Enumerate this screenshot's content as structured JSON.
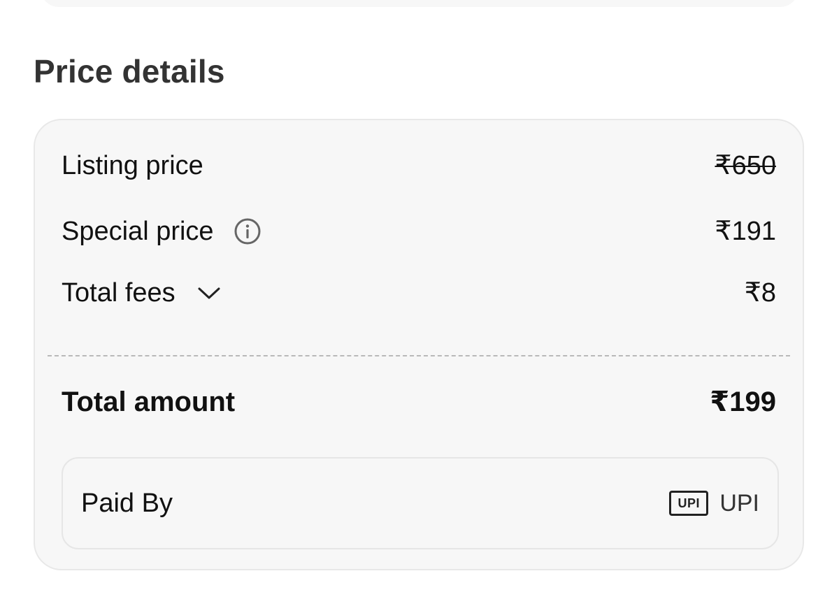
{
  "section_title": "Price details",
  "rows": {
    "listing": {
      "label": "Listing price",
      "value": "₹650"
    },
    "special": {
      "label": "Special price",
      "value": "₹191"
    },
    "fees": {
      "label": "Total fees",
      "value": "₹8"
    }
  },
  "total": {
    "label": "Total amount",
    "value": "₹199"
  },
  "payment": {
    "label": "Paid By",
    "badge": "UPI",
    "method": "UPI"
  },
  "icons": {
    "special_price_info": "info-icon",
    "fees_toggle": "chevron-down-icon",
    "payment_method": "upi-logo"
  }
}
